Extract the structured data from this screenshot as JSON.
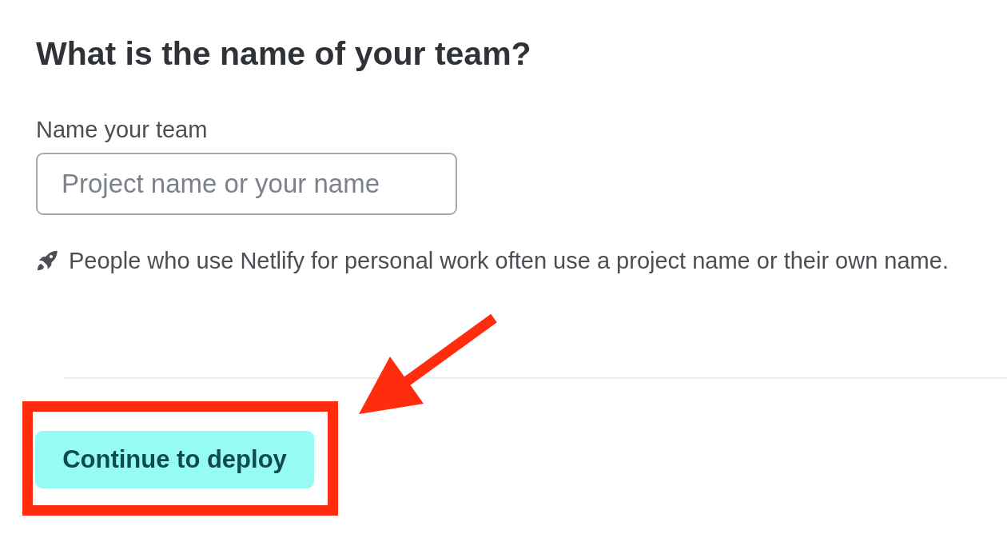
{
  "heading": "What is the name of your team?",
  "team_name_field": {
    "label": "Name your team",
    "placeholder": "Project name or your name"
  },
  "hint": {
    "text": "People who use Netlify for personal work often use a project name or their own name."
  },
  "continue_button": {
    "label": "Continue to deploy",
    "highlighted": true,
    "pointed_at": true
  }
}
